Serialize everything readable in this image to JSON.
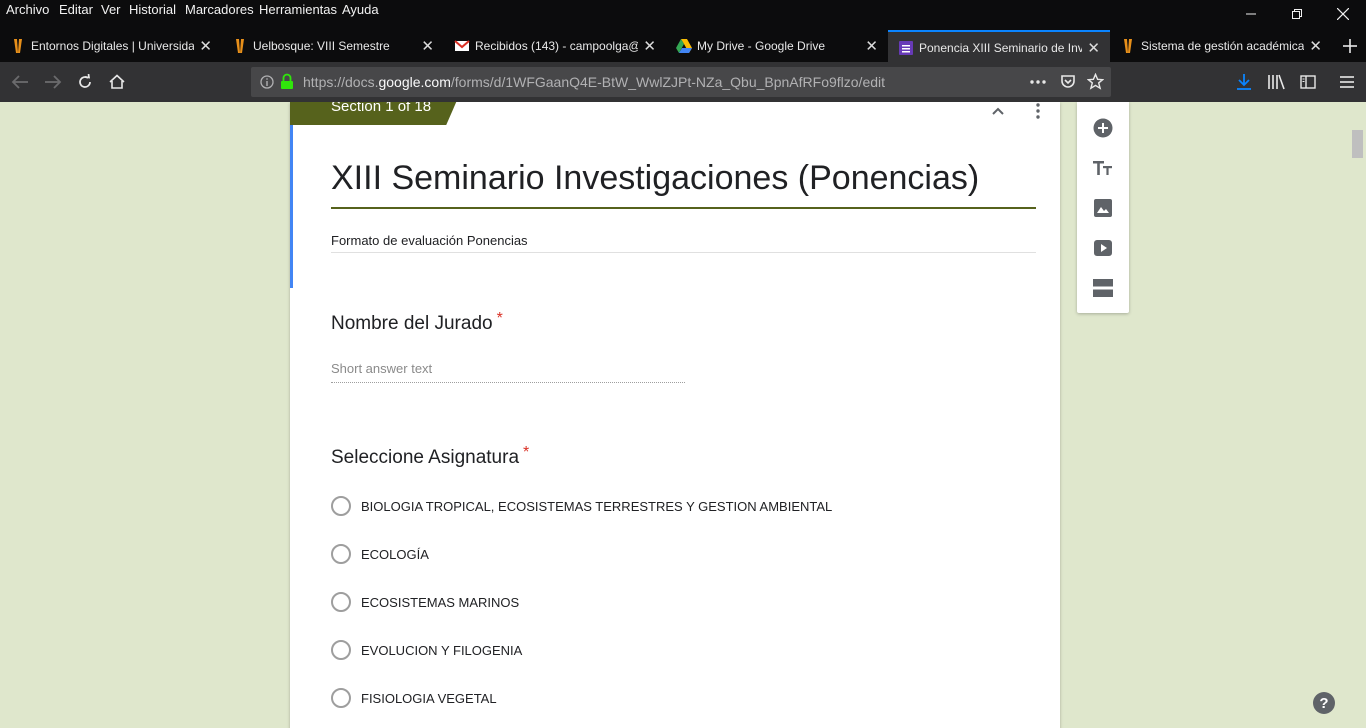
{
  "browser": {
    "menu": [
      "Archivo",
      "Editar",
      "Ver",
      "Historial",
      "Marcadores",
      "Herramientas",
      "Ayuda"
    ],
    "tabs": [
      {
        "title": "Entornos Digitales | Universidad",
        "icon": "uelbosque-logo-icon",
        "active": false
      },
      {
        "title": "Uelbosque: VIII Semestre",
        "icon": "uelbosque-logo-icon",
        "active": false
      },
      {
        "title": "Recibidos (143) - campoolga@",
        "icon": "gmail-icon",
        "active": false
      },
      {
        "title": "My Drive - Google Drive",
        "icon": "google-drive-icon",
        "active": false
      },
      {
        "title": "Ponencia XIII Seminario de Inve",
        "icon": "google-forms-icon",
        "active": true
      },
      {
        "title": "Sistema de gestión académica",
        "icon": "uelbosque-logo-icon",
        "active": false
      }
    ],
    "url_prefix": "https://docs.",
    "url_host": "google.com",
    "url_path": "/forms/d/1WFGaanQ4E-BtW_WwlZJPt-NZa_Qbu_BpnAfRFo9flzo/edit"
  },
  "form": {
    "section_label": "Section 1 of 18",
    "title": "XIII Seminario Investigaciones (Ponencias)",
    "description": "Formato de evaluación Ponencias",
    "accent_color": "#56621c",
    "questions": [
      {
        "title": "Nombre del Jurado",
        "required_mark": "*",
        "placeholder": "Short answer text"
      },
      {
        "title": "Seleccione Asignatura",
        "required_mark": "*",
        "options": [
          "BIOLOGIA TROPICAL, ECOSISTEMAS TERRESTRES Y GESTION AMBIENTAL",
          "ECOLOGÍA",
          "ECOSISTEMAS MARINOS",
          "EVOLUCION Y FILOGENIA",
          "FISIOLOGIA VEGETAL"
        ]
      }
    ]
  },
  "toolbox": [
    "add-question-icon",
    "add-title-icon",
    "add-image-icon",
    "add-video-icon",
    "add-section-icon"
  ]
}
